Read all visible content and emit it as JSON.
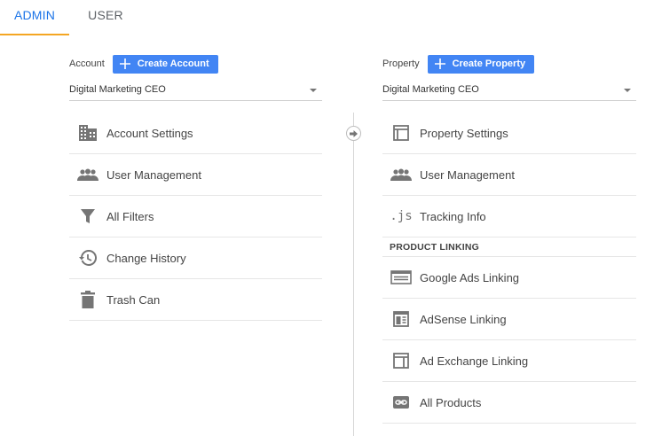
{
  "tabs": {
    "admin": "ADMIN",
    "user": "USER"
  },
  "account": {
    "label": "Account",
    "create_button": "Create Account",
    "selected": "Digital Marketing CEO",
    "items": [
      {
        "label": "Account Settings",
        "icon": "building-icon"
      },
      {
        "label": "User Management",
        "icon": "users-icon"
      },
      {
        "label": "All Filters",
        "icon": "filter-icon"
      },
      {
        "label": "Change History",
        "icon": "history-icon"
      },
      {
        "label": "Trash Can",
        "icon": "trash-icon"
      }
    ]
  },
  "property": {
    "label": "Property",
    "create_button": "Create Property",
    "selected": "Digital Marketing CEO",
    "items": [
      {
        "label": "Property Settings",
        "icon": "window-icon"
      },
      {
        "label": "User Management",
        "icon": "users-icon"
      },
      {
        "label": "Tracking Info",
        "icon": "js-icon",
        "icon_text": ".js"
      }
    ],
    "product_linking": {
      "heading": "PRODUCT LINKING",
      "items": [
        {
          "label": "Google Ads Linking",
          "icon": "ads-icon"
        },
        {
          "label": "AdSense Linking",
          "icon": "adsense-icon"
        },
        {
          "label": "Ad Exchange Linking",
          "icon": "ad-exchange-icon"
        },
        {
          "label": "All Products",
          "icon": "link-icon"
        }
      ]
    }
  },
  "colors": {
    "accent": "#1a73e8",
    "button": "#4285f4",
    "tab_underline": "#f4a623",
    "icon": "#757575"
  }
}
